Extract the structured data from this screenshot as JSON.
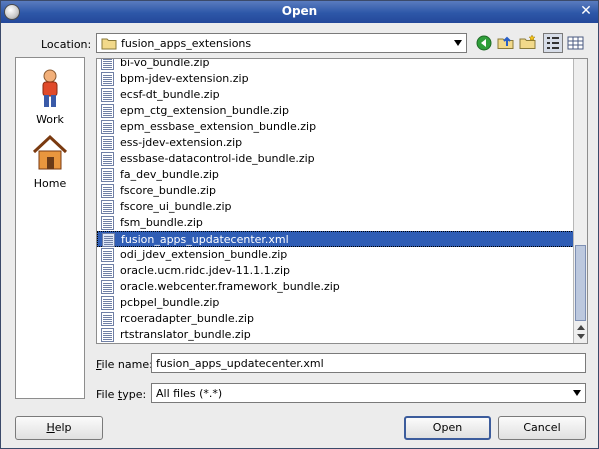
{
  "window": {
    "title": "Open",
    "close_glyph": "✕"
  },
  "location": {
    "label": "Location:",
    "value": "fusion_apps_extensions"
  },
  "toolbar": {
    "icons": [
      "back-icon",
      "up-folder-icon",
      "new-folder-icon",
      "list-view-icon",
      "details-view-icon"
    ]
  },
  "sidebar": {
    "items": [
      {
        "label": "Work",
        "icon": "person-icon"
      },
      {
        "label": "Home",
        "icon": "house-icon"
      }
    ]
  },
  "files": [
    {
      "name": "bi-vo_bundle.zip"
    },
    {
      "name": "bpm-jdev-extension.zip"
    },
    {
      "name": "ecsf-dt_bundle.zip"
    },
    {
      "name": "epm_ctg_extension_bundle.zip"
    },
    {
      "name": "epm_essbase_extension_bundle.zip"
    },
    {
      "name": "ess-jdev-extension.zip"
    },
    {
      "name": "essbase-datacontrol-ide_bundle.zip"
    },
    {
      "name": "fa_dev_bundle.zip"
    },
    {
      "name": "fscore_bundle.zip"
    },
    {
      "name": "fscore_ui_bundle.zip"
    },
    {
      "name": "fsm_bundle.zip"
    },
    {
      "name": "fusion_apps_updatecenter.xml"
    },
    {
      "name": "odi_jdev_extension_bundle.zip"
    },
    {
      "name": "oracle.ucm.ridc.jdev-11.1.1.zip"
    },
    {
      "name": "oracle.webcenter.framework_bundle.zip"
    },
    {
      "name": "pcbpel_bundle.zip"
    },
    {
      "name": "rcoeradapter_bundle.zip"
    },
    {
      "name": "rtstranslator_bundle.zip"
    }
  ],
  "selected_file_index": 11,
  "file_name": {
    "label_underlined": "F",
    "label_rest": "ile name:",
    "value": "fusion_apps_updatecenter.xml"
  },
  "file_type": {
    "label_pre": "File ",
    "label_underlined": "t",
    "label_rest": "ype:",
    "value": "All files (*.*)"
  },
  "buttons": {
    "help_underlined": "H",
    "help_rest": "elp",
    "open": "Open",
    "cancel": "Cancel"
  },
  "colors": {
    "titlebar": "#2d57a8",
    "selection": "#2f5db5"
  }
}
